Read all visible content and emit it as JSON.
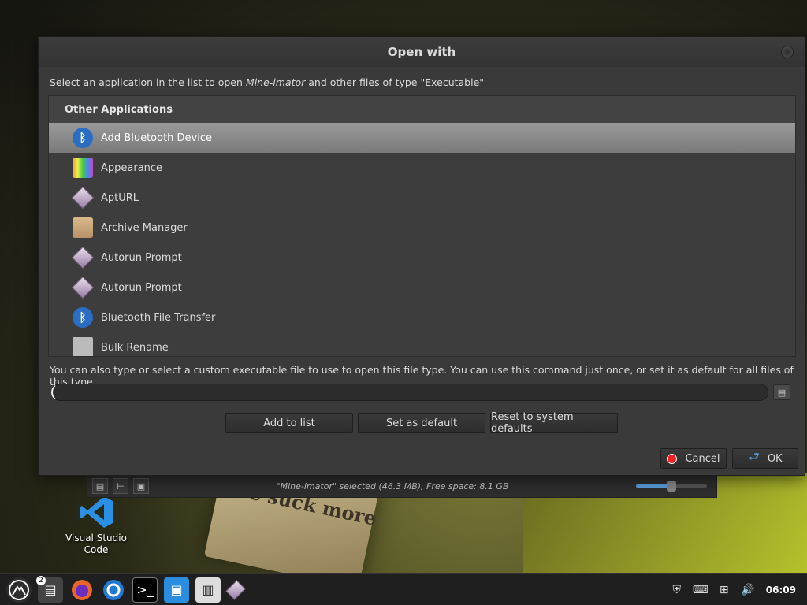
{
  "dialog": {
    "title": "Open with",
    "intro_prefix": "Select an application in the list to open ",
    "intro_filename": "Mine-imator",
    "intro_suffix": " and other files of type \"Executable\"",
    "list_header": "Other Applications",
    "apps": [
      {
        "label": "Add Bluetooth Device",
        "icon": "bluetooth-icon",
        "selected": true
      },
      {
        "label": "Appearance",
        "icon": "appearance-icon"
      },
      {
        "label": "AptURL",
        "icon": "diamond-icon"
      },
      {
        "label": "Archive Manager",
        "icon": "archive-icon"
      },
      {
        "label": "Autorun Prompt",
        "icon": "diamond-icon"
      },
      {
        "label": "Autorun Prompt",
        "icon": "diamond-icon"
      },
      {
        "label": "Bluetooth File Transfer",
        "icon": "bluetooth-icon"
      },
      {
        "label": "Bulk Rename",
        "icon": "bulk-rename-icon"
      }
    ],
    "custom_text": "You can also type or select a custom executable file to use to open this file type.  You can use this command just once, or set it as default for all files of this type.",
    "command_value": "",
    "add_to_list": "Add to list",
    "set_default": "Set as default",
    "reset_defaults": "Reset to system defaults",
    "cancel": "Cancel",
    "ok": "OK"
  },
  "file_manager": {
    "status": "\"Mine-imator\" selected (46.3 MB), Free space: 8.1 GB",
    "zoom_level": 0.5
  },
  "desktop": {
    "vscode_label": "Visual Studio Code",
    "art_text": "we suck more"
  },
  "taskbar": {
    "badge": "2",
    "clock": "06:09"
  }
}
